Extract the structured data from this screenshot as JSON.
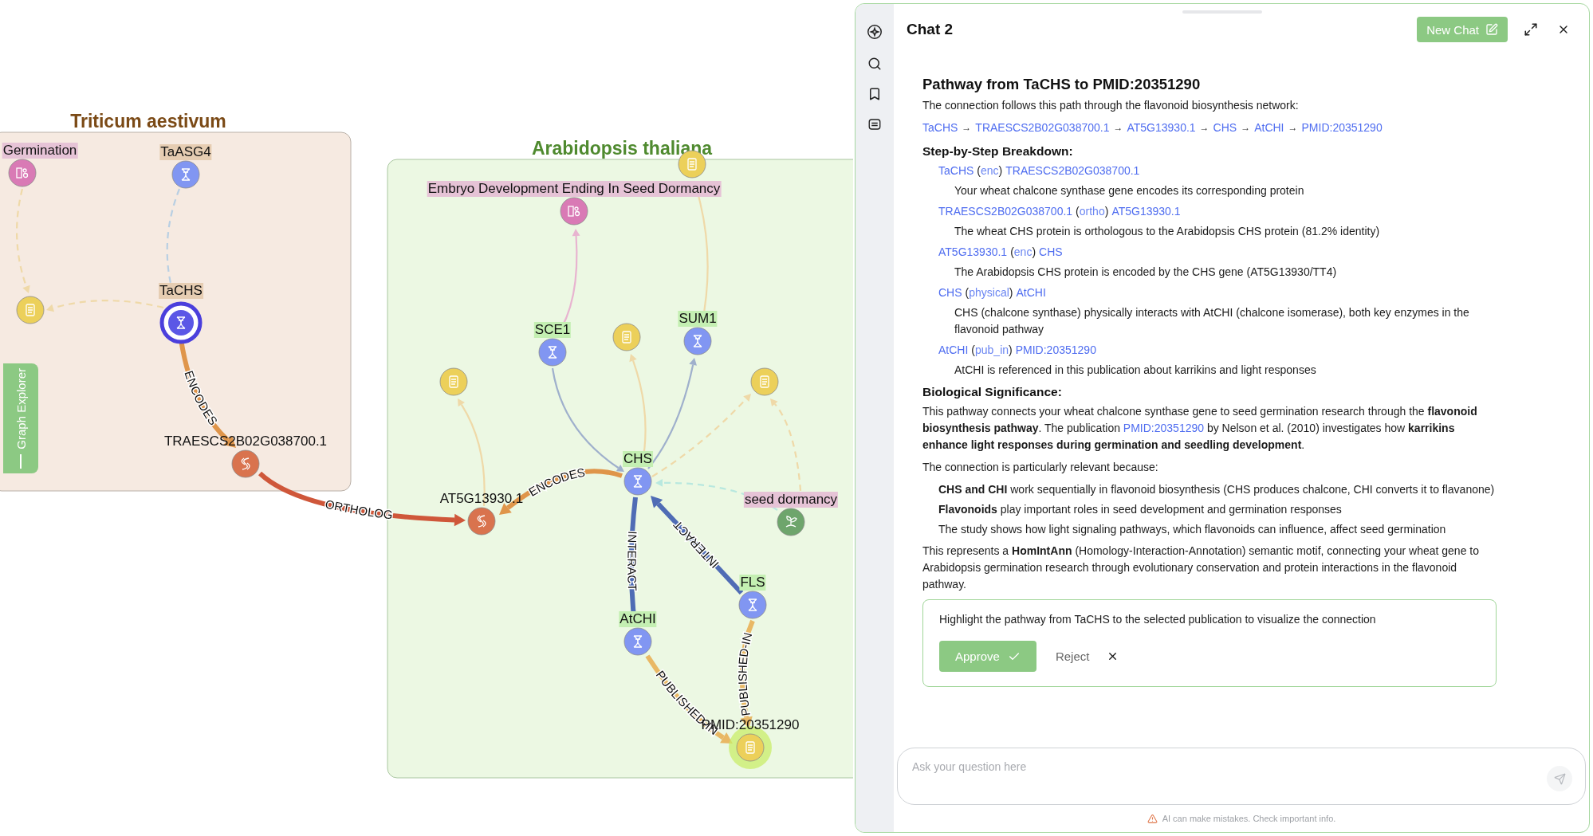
{
  "graph": {
    "groups": [
      {
        "title": "Triticum aestivum",
        "kind": "tan",
        "nodes": [
          {
            "label": "Germination",
            "kind": "process",
            "selected": false,
            "highlighted": false
          },
          {
            "label": "TaASG4",
            "kind": "gene",
            "selected": false,
            "highlighted": false
          },
          {
            "kind": "publication",
            "selected": false,
            "highlighted": false
          },
          {
            "label": "TaCHS",
            "kind": "gene",
            "selected": true,
            "highlighted": false
          },
          {
            "label": "TRAESCS2B02G038700.1",
            "kind": "protein",
            "selected": false,
            "highlighted": false
          }
        ]
      },
      {
        "title": "Arabidopsis thaliana",
        "kind": "green",
        "nodes": [
          {
            "label": "Embryo Development Ending In Seed Dormancy",
            "kind": "process",
            "selected": false,
            "highlighted": false
          },
          {
            "kind": "publication",
            "selected": false,
            "highlighted": false
          },
          {
            "label": "SCE1",
            "kind": "gene",
            "selected": false,
            "highlighted": false
          },
          {
            "kind": "publication",
            "selected": false,
            "highlighted": false
          },
          {
            "label": "SUM1",
            "kind": "gene",
            "selected": false,
            "highlighted": false
          },
          {
            "kind": "publication",
            "selected": false,
            "highlighted": false
          },
          {
            "kind": "publication",
            "selected": false,
            "highlighted": false
          },
          {
            "label": "AT5G13930.1",
            "kind": "protein",
            "selected": false,
            "highlighted": false
          },
          {
            "label": "CHS",
            "kind": "gene",
            "selected": false,
            "highlighted": false
          },
          {
            "label": "seed dormancy",
            "kind": "trait",
            "selected": false,
            "highlighted": false
          },
          {
            "label": "FLS",
            "kind": "gene",
            "selected": false,
            "highlighted": false
          },
          {
            "label": "AtCHI",
            "kind": "gene",
            "selected": false,
            "highlighted": false
          },
          {
            "label": "PMID:20351290",
            "kind": "publication",
            "selected": false,
            "highlighted": true
          }
        ]
      }
    ],
    "edges": [
      {
        "kind": "mentions",
        "dashed": true,
        "highlighted": false
      },
      {
        "kind": "related",
        "dashed": true,
        "highlighted": false
      },
      {
        "kind": "mentions",
        "dashed": true,
        "highlighted": false
      },
      {
        "kind": "encodes",
        "dashed": false,
        "highlighted": true,
        "label": "ENCODES"
      },
      {
        "kind": "ortholog",
        "dashed": false,
        "highlighted": true,
        "label": "ORTHOLOG"
      },
      {
        "kind": "encodes",
        "dashed": false,
        "highlighted": true,
        "label": "ENCODES"
      },
      {
        "kind": "associated",
        "dashed": false,
        "highlighted": false
      },
      {
        "kind": "interact",
        "dashed": false,
        "highlighted": false
      },
      {
        "kind": "mentions",
        "dashed": false,
        "highlighted": false
      },
      {
        "kind": "interact",
        "dashed": false,
        "highlighted": false
      },
      {
        "kind": "mentions",
        "dashed": false,
        "highlighted": false
      },
      {
        "kind": "mentions",
        "dashed": false,
        "highlighted": false
      },
      {
        "kind": "mentions",
        "dashed": true,
        "highlighted": false
      },
      {
        "kind": "mentions",
        "dashed": true,
        "highlighted": false
      },
      {
        "kind": "trait",
        "dashed": true,
        "highlighted": false
      },
      {
        "kind": "interact",
        "dashed": false,
        "highlighted": true,
        "label": "INTERACT"
      },
      {
        "kind": "interact",
        "dashed": false,
        "highlighted": true,
        "label": "INTERACT"
      },
      {
        "kind": "published_in",
        "dashed": false,
        "highlighted": true,
        "label": "PUBLISHED-IN"
      },
      {
        "kind": "published_in",
        "dashed": false,
        "highlighted": true,
        "label": "PUBLISHED-IN"
      }
    ]
  },
  "explorer_tab": {
    "label": "Graph Explorer"
  },
  "chat": {
    "title": "Chat 2",
    "new_chat_button": "New Chat",
    "message": {
      "heading": "Pathway from TaCHS to PMID:20351290",
      "intro": "The connection follows this path through the flavonoid biosynthesis network:",
      "path": [
        "TaCHS",
        "TRAESCS2B02G038700.1",
        "AT5G13930.1",
        "CHS",
        "AtCHI",
        "PMID:20351290"
      ],
      "path_separator": "→",
      "breakdown_title": "Step-by-Step Breakdown:",
      "steps": [
        {
          "from": "TaCHS",
          "relation": "(enc)",
          "to": "TRAESCS2B02G038700.1",
          "description": "Your wheat chalcone synthase gene encodes its corresponding protein"
        },
        {
          "from": "TRAESCS2B02G038700.1",
          "relation": "(ortho)",
          "to": "AT5G13930.1",
          "description": "The wheat CHS protein is orthologous to the Arabidopsis CHS protein (81.2% identity)"
        },
        {
          "from": "AT5G13930.1",
          "relation": "(enc)",
          "to": "CHS",
          "description": "The Arabidopsis CHS protein is encoded by the CHS gene (AT5G13930/TT4)"
        },
        {
          "from": "CHS",
          "relation": "(physical)",
          "to": "AtCHI",
          "description": "CHS (chalcone synthase) physically interacts with AtCHI (chalcone isomerase), both key enzymes in the flavonoid pathway"
        },
        {
          "from": "AtCHI",
          "relation": "(pub_in)",
          "to": "PMID:20351290",
          "description": "AtCHI is referenced in this publication about karrikins and light responses"
        }
      ],
      "significance_title": "Biological Significance:",
      "significance": {
        "before": "This pathway connects your wheat chalcone synthase gene to seed germination research through the **flavonoid biosynthesis pathway**. The publication",
        "link": "PMID:20351290",
        "after": "by Nelson et al. (2010) investigates how **karrikins enhance light responses during germination and seedling development**."
      },
      "relevance_intro": "The connection is particularly relevant because:",
      "reasons": [
        "**CHS and CHI** work sequentially in flavonoid biosynthesis (CHS produces chalcone, CHI converts it to flavanone)",
        "**Flavonoids** play important roles in seed development and germination responses",
        "The study shows how light signaling pathways, which flavonoids can influence, affect seed germination"
      ],
      "conclusion": "This represents a **HomIntAnn** (Homology-Interaction-Annotation) semantic motif, connecting your wheat gene to Arabidopsis germination research through evolutionary conservation and protein interactions in the flavonoid pathway."
    },
    "action": {
      "text": "Highlight the pathway from TaCHS to the selected publication to visualize the connection",
      "approve": "Approve",
      "reject": "Reject"
    },
    "input": {
      "placeholder": "Ask your question here"
    },
    "disclaimer": "AI can make mistakes. Check important info."
  }
}
